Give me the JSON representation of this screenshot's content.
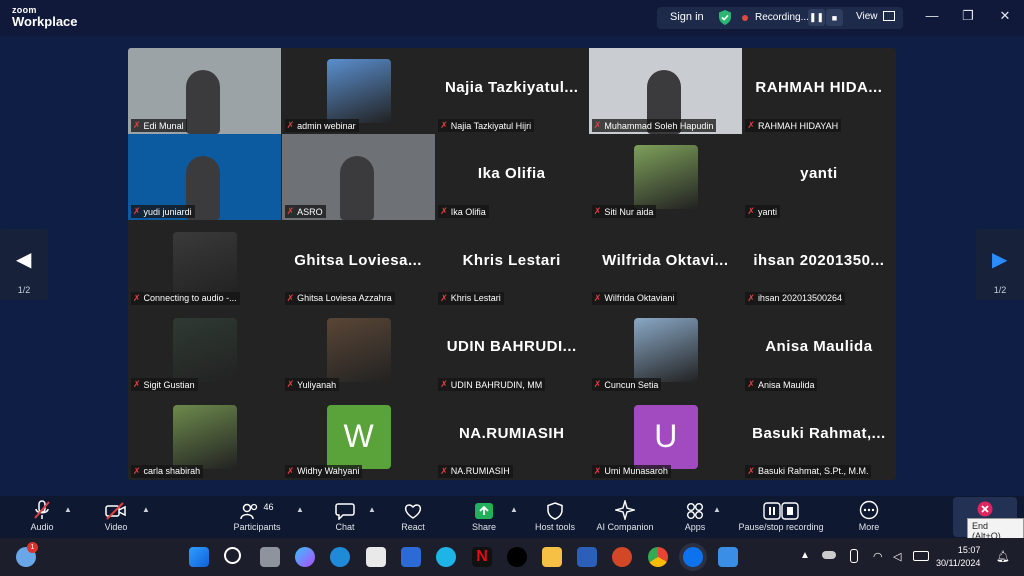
{
  "app": {
    "brand_top": "zoom",
    "brand_bottom": "Workplace"
  },
  "titlebar": {
    "sign_in": "Sign in",
    "recording": "Recording...",
    "view": "View",
    "pause": "❚❚",
    "stop": "■"
  },
  "window": {
    "minimize": "—",
    "restore": "❐",
    "close": "✕"
  },
  "pagination": {
    "left": "1/2",
    "right": "1/2"
  },
  "participants": [
    {
      "name": "Edi Munal",
      "display": "",
      "kind": "video",
      "bg": "#9ca3a7"
    },
    {
      "name": "admin webinar",
      "display": "",
      "kind": "photo",
      "bg": "#5a8fcf"
    },
    {
      "name": "Najia Tazkiyatul Hijri",
      "display": "Najia Tazkiyatul...",
      "kind": "text"
    },
    {
      "name": "Muhammad Soleh Hapudin",
      "display": "",
      "kind": "video",
      "bg": "#c9ccd0",
      "active": true
    },
    {
      "name": "RAHMAH HIDAYAH",
      "display": "RAHMAH HIDA...",
      "kind": "text"
    },
    {
      "name": "yudi juniardi",
      "display": "",
      "kind": "video",
      "bg": "#0c5aa0"
    },
    {
      "name": "ASRO",
      "display": "",
      "kind": "video",
      "bg": "#6e7176"
    },
    {
      "name": "Ika Olifia",
      "display": "Ika Olifia",
      "kind": "text"
    },
    {
      "name": "Siti Nur aida",
      "display": "",
      "kind": "photo",
      "bg": "#7ea05a"
    },
    {
      "name": "yanti",
      "display": "yanti",
      "kind": "text"
    },
    {
      "name": "Connecting to audio -...",
      "display": "",
      "kind": "photo",
      "bg": "#3a3a3a"
    },
    {
      "name": "Ghitsa Loviesa Azzahra",
      "display": "Ghitsa Loviesa...",
      "kind": "text"
    },
    {
      "name": "Khris Lestari",
      "display": "Khris Lestari",
      "kind": "text"
    },
    {
      "name": "Wilfrida Oktaviani",
      "display": "Wilfrida Oktavi...",
      "kind": "text"
    },
    {
      "name": "ihsan 202013500264",
      "display": "ihsan 20201350...",
      "kind": "text"
    },
    {
      "name": "Sigit Gustian",
      "display": "",
      "kind": "photo",
      "bg": "#2f3a33"
    },
    {
      "name": "Yuliyanah",
      "display": "",
      "kind": "photo",
      "bg": "#5a4636"
    },
    {
      "name": "UDIN BAHRUDIN, MM",
      "display": "UDIN BAHRUDI...",
      "kind": "text"
    },
    {
      "name": "Cuncun Setia",
      "display": "",
      "kind": "photo",
      "bg": "#8aa8c6"
    },
    {
      "name": "Anisa Maulida",
      "display": "Anisa Maulida",
      "kind": "text"
    },
    {
      "name": "carla shabirah",
      "display": "",
      "kind": "photo",
      "bg": "#6d8a4c"
    },
    {
      "name": "Widhy Wahyani",
      "display": "W",
      "kind": "letter",
      "bg": "#5aa23a"
    },
    {
      "name": "NA.RUMIASIH",
      "display": "NA.RUMIASIH",
      "kind": "text"
    },
    {
      "name": "Umi Munasaroh",
      "display": "U",
      "kind": "letter",
      "bg": "#a24bc0"
    },
    {
      "name": "Basuki Rahmat, S.Pt., M.M.",
      "display": "Basuki Rahmat,...",
      "kind": "text"
    }
  ],
  "toolbar": {
    "audio": "Audio",
    "video": "Video",
    "participants": "Participants",
    "participants_count": "46",
    "chat": "Chat",
    "react": "React",
    "share": "Share",
    "host_tools": "Host tools",
    "ai_companion": "AI Companion",
    "apps": "Apps",
    "pause_stop_recording": "Pause/stop recording",
    "more": "More",
    "end_tooltip": "End (Alt+Q)"
  },
  "taskbar": {
    "time": "15:07",
    "date": "30/11/2024",
    "weather_badge": "1"
  },
  "colors": {
    "accent_green": "#22c55e",
    "muted_red": "#e04040",
    "zoom_blue": "#0e72ed"
  }
}
